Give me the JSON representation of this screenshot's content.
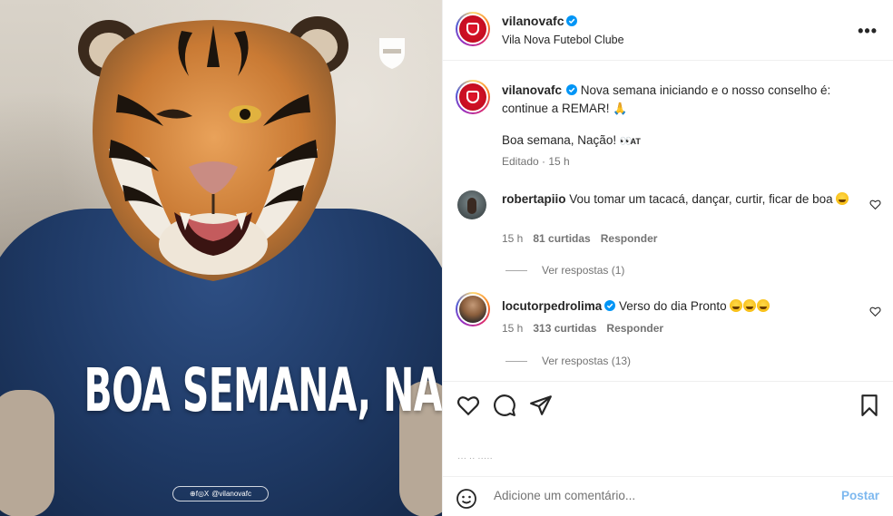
{
  "media": {
    "headline": "BOA SEMANA, NAÇÃO!",
    "socials_handle": "@vilanovafc",
    "socials_icons": "⊕f◎X"
  },
  "header": {
    "username": "vilanovafc",
    "subtitle": "Vila Nova Futebol Clube",
    "more_icon": "•••"
  },
  "caption": {
    "username": "vilanovafc",
    "line1": "Nova semana iniciando e o nosso conselho é: continue a REMAR!",
    "emoji1": "🙏",
    "line2": "Boa semana, Nação!",
    "emoji2_label": "AT",
    "meta": "Editado · 15 h"
  },
  "comments": [
    {
      "username": "robertapiio",
      "text": "Vou tomar um tacacá, dançar, curtir, ficar de boa",
      "time": "15 h",
      "likes": "81 curtidas",
      "reply": "Responder",
      "view_replies": "Ver respostas (1)"
    },
    {
      "username": "locutorpedrolima",
      "text": "Verso do dia Pronto",
      "time": "15 h",
      "likes": "313 curtidas",
      "reply": "Responder",
      "view_replies": "Ver respostas (13)"
    }
  ],
  "ghost_text": "··· ·· ·····",
  "add_comment": {
    "placeholder": "Adicione um comentário...",
    "post_label": "Postar"
  },
  "colors": {
    "brand_red": "#d4142a",
    "verified_blue": "#0095f6",
    "post_button": "#7db8ef",
    "shirt_blue": "#1f3a66"
  }
}
